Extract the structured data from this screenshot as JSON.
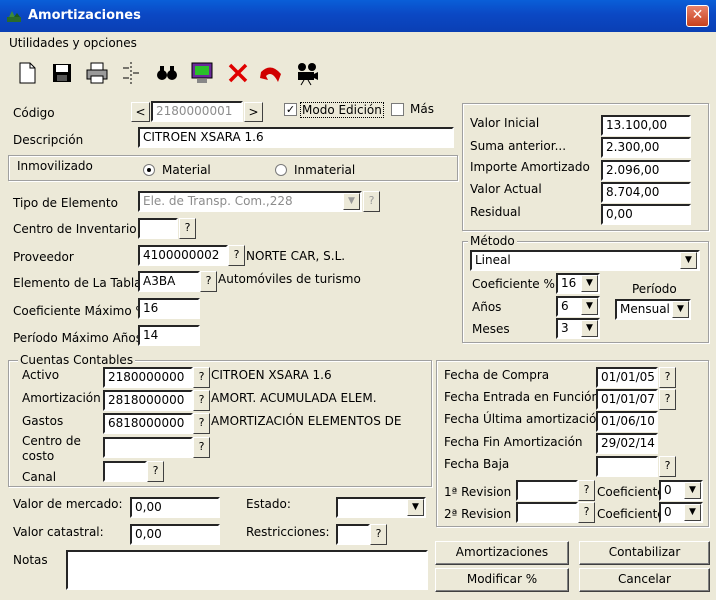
{
  "window": {
    "title": "Amortizaciones",
    "close": "✕"
  },
  "menu": {
    "utilities": "Utilidades y opciones"
  },
  "codigo": {
    "label": "Código",
    "value": "2180000001",
    "prev": "<",
    "next": ">",
    "modo_edicion": "Modo Edición",
    "modo_edicion_checked": true,
    "mas": "Más",
    "mas_checked": false
  },
  "descripcion": {
    "label": "Descripción",
    "value": "CITROEN XSARA 1.6"
  },
  "inmovilizado": {
    "label": "Inmovilizado",
    "material": "Material",
    "inmaterial": "Inmaterial",
    "selected": "Material"
  },
  "tipo_elemento": {
    "label": "Tipo de Elemento",
    "value": "Ele. de Transp. Com.,228"
  },
  "centro_inventario": {
    "label": "Centro de Inventario",
    "value": ""
  },
  "proveedor": {
    "label": "Proveedor",
    "value": "4100000002",
    "name": "NORTE CAR, S.L."
  },
  "elemento_tabla": {
    "label": "Elemento de La Tabla",
    "value": "A3BA",
    "name": "Automóviles de turismo"
  },
  "coef_maximo": {
    "label": "Coeficiente Máximo %",
    "value": "16"
  },
  "periodo_maximo": {
    "label": "Período Máximo Años",
    "value": "14"
  },
  "valores": {
    "valor_inicial": {
      "label": "Valor Inicial",
      "value": "13.100,00"
    },
    "suma_anterior": {
      "label": "Suma anterior...",
      "value": "2.300,00"
    },
    "importe_amortizado": {
      "label": "Importe Amortizado",
      "value": "2.096,00"
    },
    "valor_actual": {
      "label": "Valor Actual",
      "value": "8.704,00"
    },
    "residual": {
      "label": "Residual",
      "value": "0,00"
    }
  },
  "metodo": {
    "label": "Método",
    "value": "Lineal",
    "coeficiente": {
      "label": "Coeficiente %",
      "value": "16"
    },
    "anos": {
      "label": "Años",
      "value": "6"
    },
    "meses": {
      "label": "Meses",
      "value": "3"
    },
    "periodo": {
      "label": "Período",
      "value": "Mensual"
    }
  },
  "cuentas": {
    "label": "Cuentas Contables",
    "activo": {
      "label": "Activo",
      "value": "2180000000",
      "desc": "CITROEN XSARA 1.6"
    },
    "amortizacion": {
      "label": "Amortización",
      "value": "2818000000",
      "desc": "AMORT. ACUMULADA ELEM."
    },
    "gastos": {
      "label": "Gastos",
      "value": "6818000000",
      "desc": "AMORTIZACIÓN ELEMENTOS DE"
    },
    "centro_costo": {
      "label1": "Centro de",
      "label2": "costo",
      "value": ""
    },
    "canal": {
      "label": "Canal",
      "value": ""
    }
  },
  "fechas": {
    "compra": {
      "label": "Fecha de Compra",
      "value": "01/01/05"
    },
    "entrada_funcion": {
      "label": "Fecha Entrada en Función",
      "value": "01/01/07"
    },
    "ultima_amortizacion": {
      "label": "Fecha Última amortización",
      "value": "01/06/10"
    },
    "fin_amortizacion": {
      "label": "Fecha Fin Amortización",
      "value": "29/02/14"
    },
    "baja": {
      "label": "Fecha Baja",
      "value": ""
    },
    "revision1": {
      "label": "1ª Revision",
      "value": "",
      "coef_label": "Coeficiente",
      "coef": "0"
    },
    "revision2": {
      "label": "2ª Revision",
      "value": "",
      "coef_label": "Coeficiente",
      "coef": "0"
    }
  },
  "valor_mercado": {
    "label": "Valor de mercado:",
    "value": "0,00"
  },
  "valor_catastral": {
    "label": "Valor catastral:",
    "value": "0,00"
  },
  "estado": {
    "label": "Estado:",
    "value": ""
  },
  "restricciones": {
    "label": "Restricciones:",
    "value": ""
  },
  "notas": {
    "label": "Notas",
    "value": ""
  },
  "buttons": {
    "amortizaciones": "Amortizaciones",
    "contabilizar": "Contabilizar",
    "modificar": "Modificar %",
    "cancelar": "Cancelar"
  },
  "toolbar": [
    "new-document-icon",
    "save-icon",
    "print-icon",
    "split-icon",
    "search-binoculars-icon",
    "monitor-icon",
    "delete-icon",
    "undo-icon",
    "projector-icon"
  ],
  "q": "?",
  "arrow": "▼"
}
